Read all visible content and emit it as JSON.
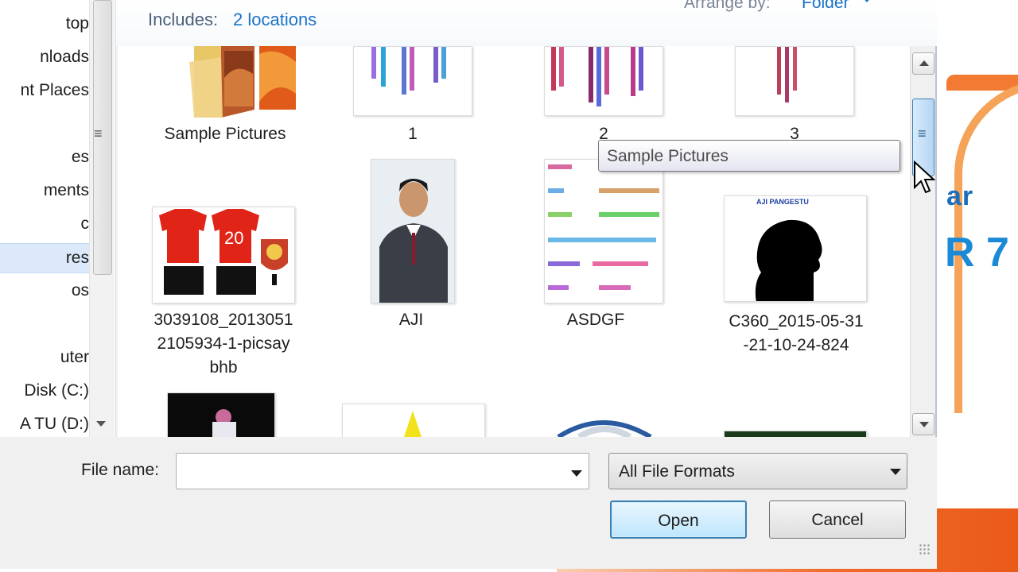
{
  "header": {
    "includes_label": "Includes:",
    "includes_link": "2 locations",
    "arrange_label": "Arrange by:",
    "arrange_value": "Folder"
  },
  "nav": {
    "items": [
      {
        "label": "top"
      },
      {
        "label": "nloads"
      },
      {
        "label": "nt Places"
      },
      {
        "label": "es"
      },
      {
        "label": "ments"
      },
      {
        "label": "c"
      },
      {
        "label": "res",
        "selected": true
      },
      {
        "label": "os"
      },
      {
        "label": "uter"
      },
      {
        "label": " Disk (C:)"
      },
      {
        "label": "A TU (D:)"
      }
    ]
  },
  "content": {
    "items": [
      {
        "label": "Sample Pictures",
        "icon": "folder-icon"
      },
      {
        "label": "1"
      },
      {
        "label": "2"
      },
      {
        "label": "3"
      },
      {
        "label_lines": [
          "3039108_2013051",
          "2105934-1-picsay",
          "bhb"
        ]
      },
      {
        "label": "AJI"
      },
      {
        "label": "ASDGF"
      },
      {
        "label_lines": [
          "C360_2015-05-31",
          "-21-10-24-824"
        ]
      }
    ],
    "thumbnail_text": {
      "jersey_number": "20",
      "silhouette_caption": "AJI PANGESTU"
    },
    "tooltip": "Sample Pictures"
  },
  "footer": {
    "file_name_label": "File name:",
    "file_name_value": "",
    "file_type": "All File Formats",
    "open_label": "Open",
    "cancel_label": "Cancel"
  },
  "background": {
    "text1": "ar",
    "text2": "R 7"
  },
  "colors": {
    "link_blue": "#1c73c5",
    "selection": "#dbe9fa",
    "scroll_thumb": "#b5d5f3",
    "accent_orange": "#f06a28"
  }
}
